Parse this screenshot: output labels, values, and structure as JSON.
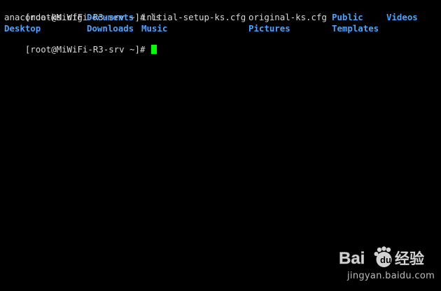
{
  "terminal": {
    "line1": {
      "prompt": "[root@MiWiFi-R3-srv ~]#",
      "command": "ls"
    },
    "listing": {
      "row1": [
        {
          "name": "anaconda-ks.cfg",
          "type": "file"
        },
        {
          "name": "Documents",
          "type": "dir"
        },
        {
          "name": "initial-setup-ks.cfg",
          "type": "file"
        },
        {
          "name": "original-ks.cfg",
          "type": "file"
        },
        {
          "name": "Public",
          "type": "dir"
        },
        {
          "name": "Videos",
          "type": "dir"
        }
      ],
      "row2": [
        {
          "name": "Desktop",
          "type": "dir"
        },
        {
          "name": "Downloads",
          "type": "dir"
        },
        {
          "name": "Music",
          "type": "dir"
        },
        {
          "name": "Pictures",
          "type": "dir"
        },
        {
          "name": "Templates",
          "type": "dir"
        }
      ]
    },
    "line4": {
      "prompt": "[root@MiWiFi-R3-srv ~]#"
    },
    "colors": {
      "background": "#000000",
      "text": "#d8d8d8",
      "directory": "#4aa3ff",
      "cursor": "#00ff00"
    }
  },
  "watermark": {
    "brand_left": "Bai",
    "brand_right": "经验",
    "url": "jingyan.baidu.com",
    "icon": "paw-icon"
  }
}
